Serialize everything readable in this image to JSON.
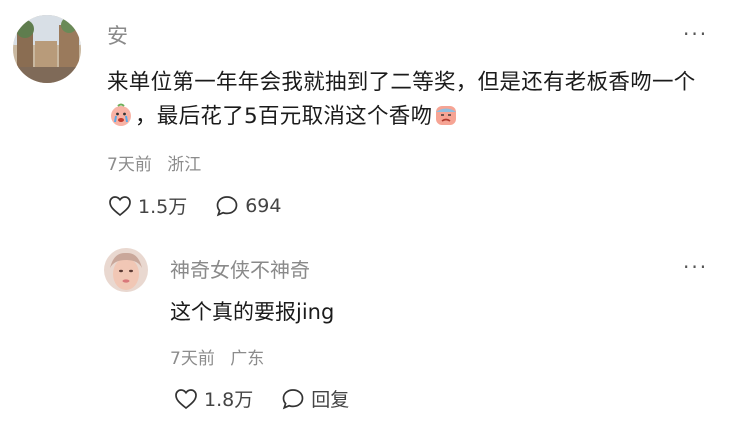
{
  "comment": {
    "username": "安",
    "more": "···",
    "text_part1": "来单位第一年年会我就抽到了二等奖，但是还有老板香吻一个",
    "text_part2": "，最后花了5百元取消这个香吻",
    "emoji1": "crying-face-emoji",
    "emoji2": "sad-face-emoji",
    "time": "7天前",
    "location": "浙江",
    "like_count": "1.5万",
    "reply_count": "694"
  },
  "reply": {
    "username": "神奇女侠不神奇",
    "more": "···",
    "text": "这个真的要报jing",
    "time": "7天前",
    "location": "广东",
    "like_count": "1.8万",
    "reply_label": "回复"
  },
  "colors": {
    "text": "#1b1b1b",
    "meta": "#8c8c8c",
    "username": "#8a8a8a"
  }
}
